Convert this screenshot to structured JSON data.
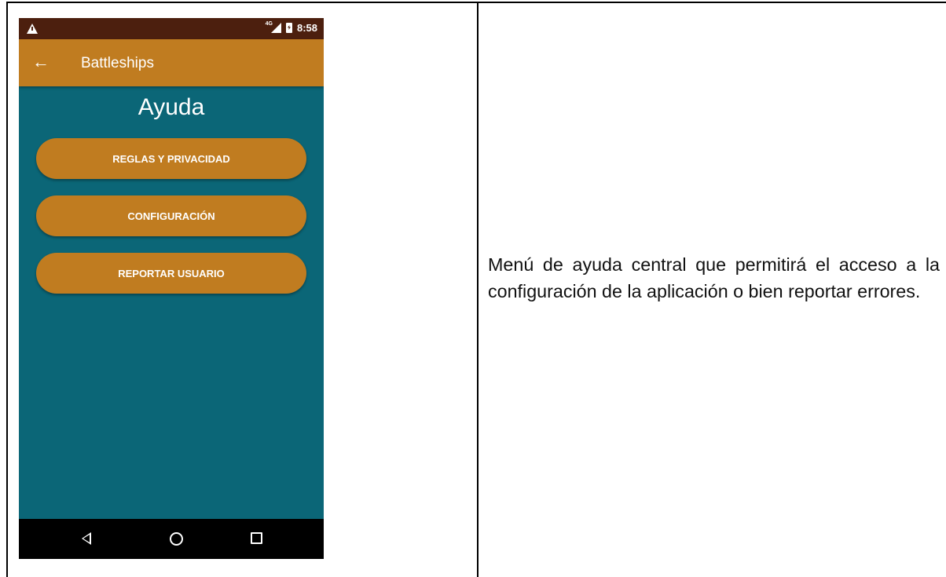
{
  "status_bar": {
    "warning_icon": "warning-icon",
    "network": "4G",
    "time": "8:58"
  },
  "app_bar": {
    "back_icon": "arrow-left-icon",
    "title": "Battleships"
  },
  "screen": {
    "title": "Ayuda",
    "buttons": [
      {
        "label": "REGLAS Y PRIVACIDAD"
      },
      {
        "label": "CONFIGURACIÓN"
      },
      {
        "label": "REPORTAR USUARIO"
      }
    ]
  },
  "nav_bar": {
    "back_icon": "triangle-back-icon",
    "home_icon": "circle-home-icon",
    "recents_icon": "square-recents-icon"
  },
  "description": "Menú de ayuda central que permitirá el acceso a la configuración de la aplicación o bien reportar errores.",
  "colors": {
    "status_bar": "#4c1f0e",
    "app_bar": "#c07c20",
    "background": "#0b6677",
    "button": "#c07c20",
    "nav_bar": "#000000"
  }
}
